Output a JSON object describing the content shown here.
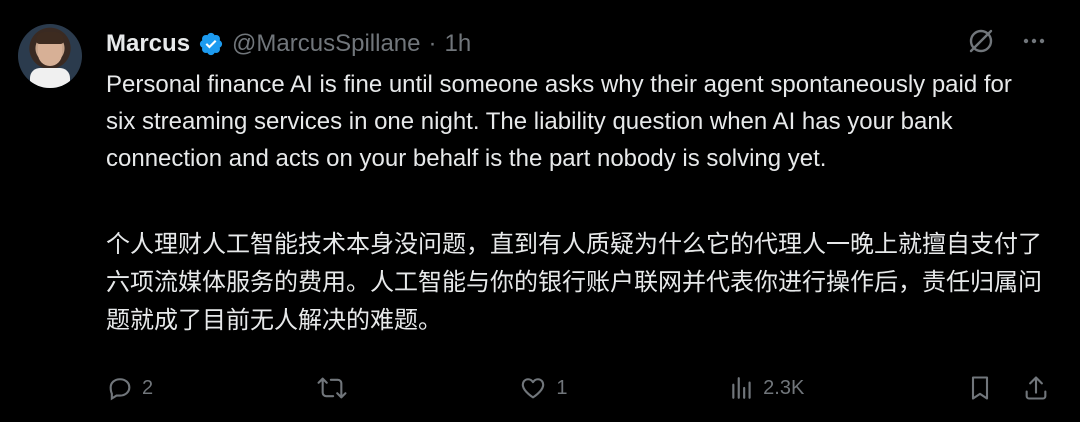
{
  "author": {
    "name": "Marcus",
    "handle": "@MarcusSpillane",
    "separator": "·",
    "time": "1h"
  },
  "tweet": {
    "text_en": "Personal finance AI is fine until someone asks why their agent spontaneously paid for six streaming services in one night. The liability question when AI has your bank connection and acts on your behalf is the part nobody is solving yet.",
    "text_zh": "个人理财人工智能技术本身没问题，直到有人质疑为什么它的代理人一晚上就擅自支付了六项流媒体服务的费用。人工智能与你的银行账户联网并代表你进行操作后，责任归属问题就成了目前无人解决的难题。"
  },
  "actions": {
    "replies": "2",
    "retweets": "",
    "likes": "1",
    "views": "2.3K"
  },
  "icons": {
    "verified": "verified-badge-icon",
    "grok": "grok-icon",
    "more": "more-icon",
    "reply": "reply-icon",
    "retweet": "retweet-icon",
    "like": "heart-icon",
    "views": "views-icon",
    "bookmark": "bookmark-icon",
    "share": "share-icon"
  },
  "colors": {
    "background": "#000000",
    "text": "#e7e9ea",
    "muted": "#71767b",
    "verified": "#1d9bf0"
  }
}
